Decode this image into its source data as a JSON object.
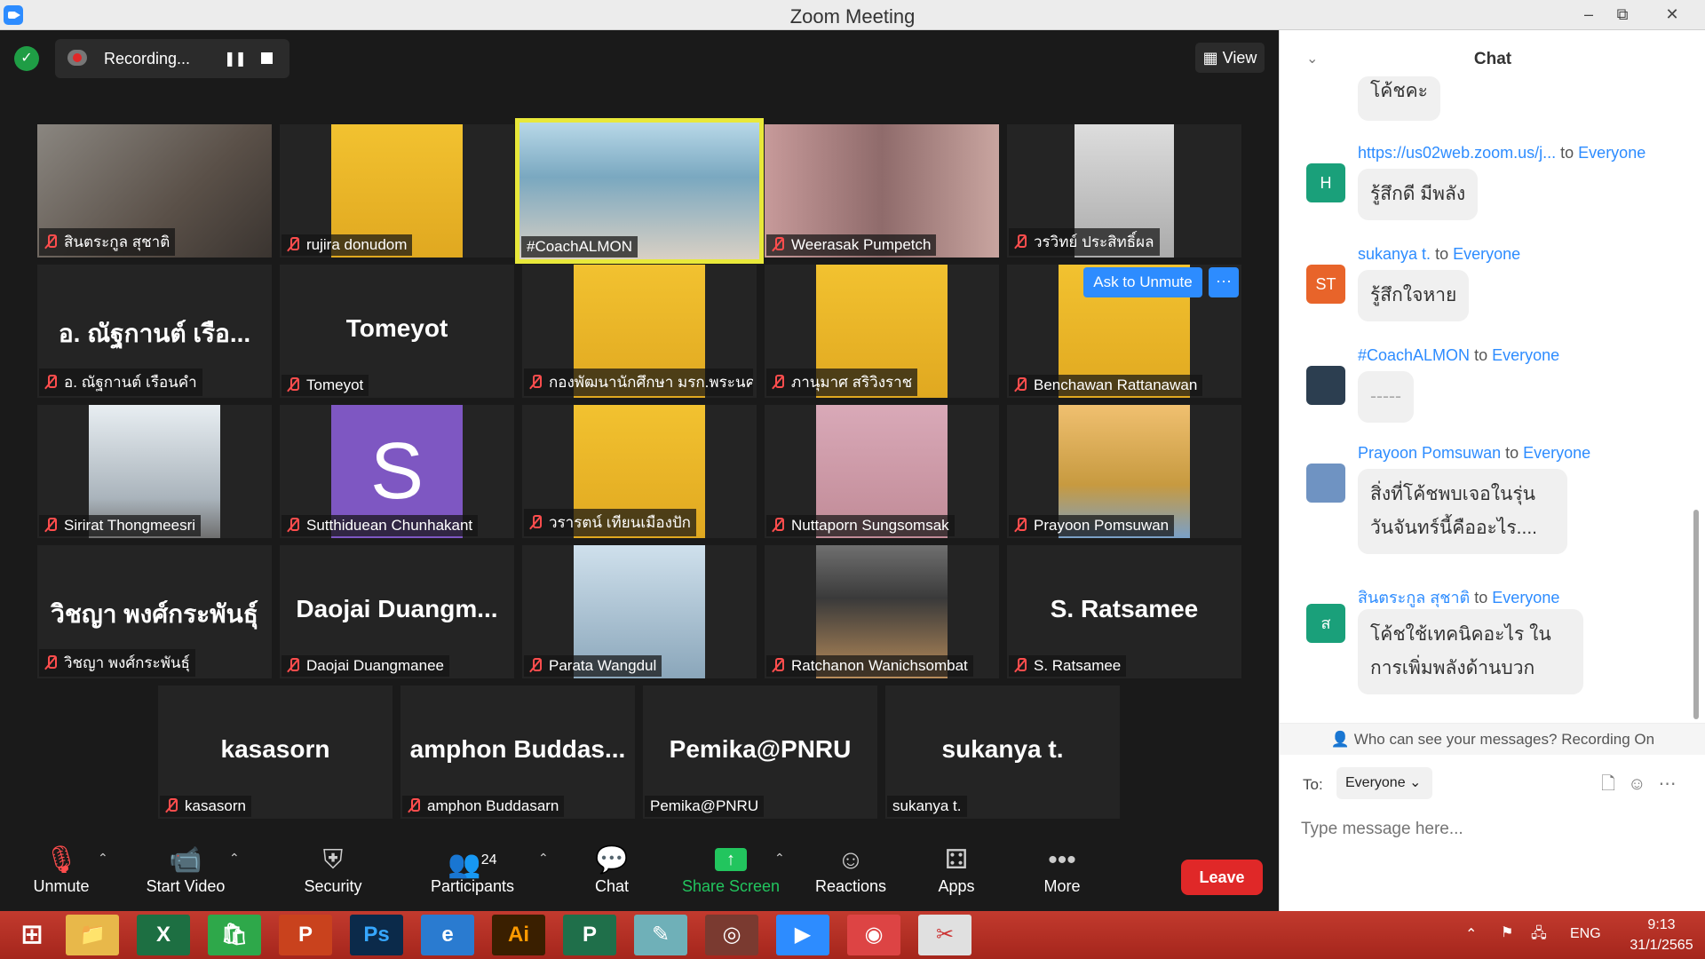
{
  "window": {
    "title": "Zoom Meeting",
    "minimize": "–",
    "restore": "⧉",
    "close": "✕"
  },
  "recording": {
    "label": "Recording..."
  },
  "view_button": {
    "label": "View"
  },
  "ask_unmute": "Ask to Unmute",
  "more_dots": "···",
  "tiles": [
    {
      "name": "สินตระกูล สุชาติ",
      "muted": true,
      "video": "photo"
    },
    {
      "name": "rujira donudom",
      "muted": true,
      "video": "photo"
    },
    {
      "name": "#CoachALMON",
      "muted": false,
      "video": "photo",
      "active": true
    },
    {
      "name": "Weerasak Pumpetch",
      "muted": true,
      "video": "photo"
    },
    {
      "name": "วรวิทย์ ประสิทธิ์ผล",
      "muted": true,
      "video": "photo"
    },
    {
      "name": "อ. ณัฐกานต์ เรือนคำ",
      "muted": true,
      "big": "อ. ณัฐกานต์  เรือ..."
    },
    {
      "name": "Tomeyot",
      "muted": true,
      "big": "Tomeyot"
    },
    {
      "name": "กองพัฒนานักศึกษา มรก.พระนคร",
      "muted": true,
      "video": "photo"
    },
    {
      "name": "ภานุมาศ สริวิงราช",
      "muted": true,
      "video": "photo"
    },
    {
      "name": "Benchawan Rattanawan",
      "muted": true,
      "video": "photo"
    },
    {
      "name": "Sirirat Thongmeesri",
      "muted": true,
      "video": "photo"
    },
    {
      "name": "Sutthiduean Chunhakant",
      "muted": true,
      "avatar_letter": "S"
    },
    {
      "name": "วรารตน์ เทียนเมืองปัก",
      "muted": true,
      "video": "photo"
    },
    {
      "name": "Nuttaporn Sungsomsak",
      "muted": true,
      "video": "photo"
    },
    {
      "name": "Prayoon Pomsuwan",
      "muted": true,
      "video": "photo"
    },
    {
      "name": "วิชญา พงศ์กระพันธุ์",
      "muted": true,
      "big": "วิชญา  พงศ์กระพันธุ์"
    },
    {
      "name": "Daojai Duangmanee",
      "muted": true,
      "big": "Daojai  Duangm..."
    },
    {
      "name": "Parata Wangdul",
      "muted": true,
      "video": "photo"
    },
    {
      "name": "Ratchanon Wanichsombat",
      "muted": true,
      "video": "photo"
    },
    {
      "name": "S. Ratsamee",
      "muted": true,
      "big": "S. Ratsamee"
    },
    {
      "name": "kasasorn",
      "muted": true,
      "big": "kasasorn"
    },
    {
      "name": "amphon Buddasarn",
      "muted": true,
      "big": "amphon  Buddas..."
    },
    {
      "name": "Pemika@PNRU",
      "muted": false,
      "big": "Pemika@PNRU"
    },
    {
      "name": "sukanya t.",
      "muted": false,
      "big": "sukanya t."
    }
  ],
  "toolbar": {
    "unmute": "Unmute",
    "start_video": "Start Video",
    "security": "Security",
    "participants": "Participants",
    "participants_count": "24",
    "chat": "Chat",
    "share_screen": "Share Screen",
    "reactions": "Reactions",
    "apps": "Apps",
    "more": "More",
    "leave": "Leave"
  },
  "chat": {
    "title": "Chat",
    "messages": [
      {
        "top_bubble": "โค้ชคะ"
      },
      {
        "sender": "https://us02web.zoom.us/j...",
        "to": "to",
        "recipient": "Everyone",
        "avatar": "H",
        "avatar_color": "#1aa07a",
        "text": "รู้สึกดี มีพลัง"
      },
      {
        "sender": "sukanya t.",
        "to": "to",
        "recipient": "Everyone",
        "avatar": "ST",
        "avatar_color": "#e8642a",
        "text": "รู้สึกใจหาย"
      },
      {
        "sender": "#CoachALMON",
        "to": "to",
        "recipient": "Everyone",
        "avatar": "",
        "avatar_color": "#2c3e50",
        "text": "-----"
      },
      {
        "sender": "Prayoon Pomsuwan",
        "to": "to",
        "recipient": "Everyone",
        "avatar": "",
        "avatar_color": "#6f93c2",
        "text": "สิ่งที่โค้ชพบเจอในรุ่นวันจันทร์นี้คืออะไร...."
      },
      {
        "sender": "สินตระกูล สุชาติ",
        "to": "to",
        "recipient": "Everyone",
        "avatar": "ส",
        "avatar_color": "#1aa07a",
        "text": "โค้ชใช้เทคนิคอะไร ในการเพิ่มพลังด้านบวก"
      }
    ],
    "who_can_see": "Who can see your messages? Recording On",
    "to_label": "To:",
    "recipient_select": "Everyone",
    "input_placeholder": "Type message here..."
  },
  "taskbar": {
    "lang": "ENG",
    "time": "9:13",
    "date": "31/1/2565",
    "apps": [
      "Ps",
      "Ai"
    ]
  },
  "colors": {
    "accent": "#2d8cff",
    "leave": "#e02828",
    "share": "#22c55e",
    "taskbar": "#b22d22"
  }
}
